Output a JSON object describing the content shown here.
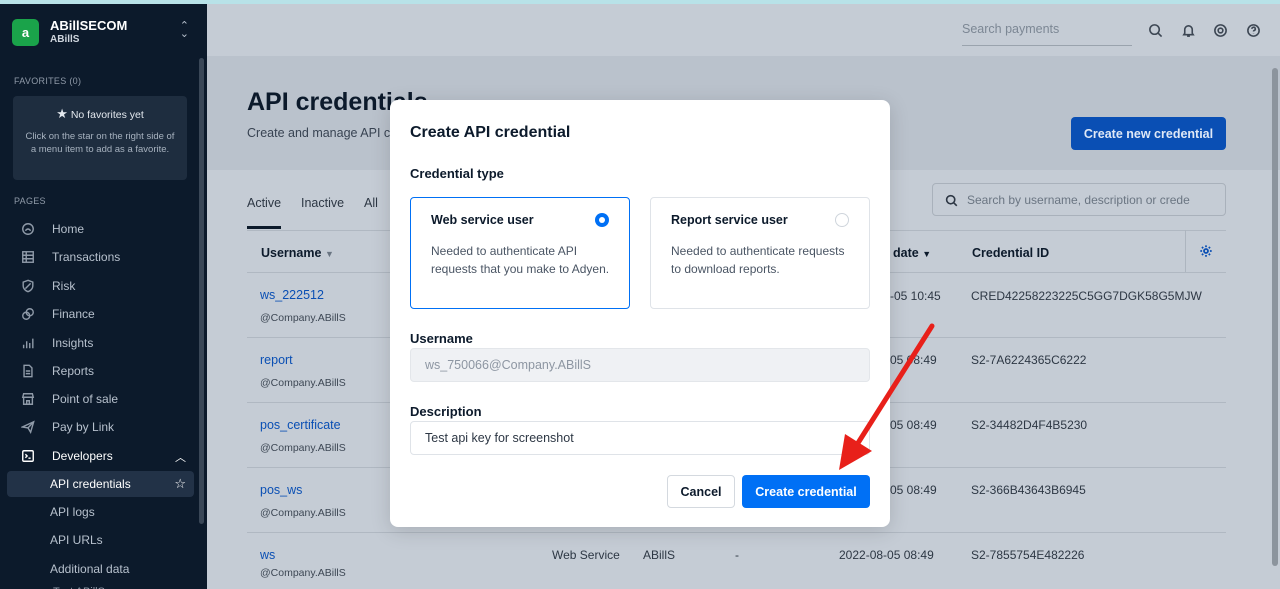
{
  "account": {
    "logo": "a",
    "name": "ABillSECOM",
    "sub": "ABillS"
  },
  "sidebar": {
    "favorites_label": "FAVORITES (0)",
    "favorites_title": "No favorites yet",
    "favorites_desc": "Click on the star on the right side of a menu item to add as a favorite.",
    "pages_label": "PAGES",
    "items": [
      {
        "label": "Home",
        "icon": "home-icon"
      },
      {
        "label": "Transactions",
        "icon": "table-icon"
      },
      {
        "label": "Risk",
        "icon": "shield-icon"
      },
      {
        "label": "Finance",
        "icon": "coins-icon"
      },
      {
        "label": "Insights",
        "icon": "bar-chart-icon"
      },
      {
        "label": "Reports",
        "icon": "document-icon"
      },
      {
        "label": "Point of sale",
        "icon": "store-icon"
      },
      {
        "label": "Pay by Link",
        "icon": "send-icon"
      },
      {
        "label": "Developers",
        "icon": "terminal-icon"
      }
    ],
    "sub_items": [
      {
        "label": "API credentials"
      },
      {
        "label": "API logs"
      },
      {
        "label": "API URLs"
      },
      {
        "label": "Additional data"
      }
    ],
    "cutoff_label": "Test ABillS"
  },
  "topbar": {
    "search_placeholder": "Search payments"
  },
  "page": {
    "title": "API credentials",
    "subtitle": "Create and manage API cre",
    "create_button": "Create new credential",
    "tabs": [
      "Active",
      "Inactive",
      "All"
    ],
    "filter_placeholder": "Search by username, description or crede"
  },
  "table": {
    "headers": {
      "username": "Username",
      "date": "date",
      "credential_id": "Credential ID"
    },
    "rows": [
      {
        "username": "ws_222512",
        "company": "@Company.ABillS",
        "type": "",
        "account": "",
        "desc": "",
        "date": "-05 10:45",
        "id": "CRED42258223225C5GG7DGK58G5MJW"
      },
      {
        "username": "report",
        "company": "@Company.ABillS",
        "type": "",
        "account": "",
        "desc": "",
        "date": "05 08:49",
        "id": "S2-7A6224365C6222"
      },
      {
        "username": "pos_certificate",
        "company": "@Company.ABillS",
        "type": "",
        "account": "",
        "desc": "",
        "date": "05 08:49",
        "id": "S2-34482D4F4B5230"
      },
      {
        "username": "pos_ws",
        "company": "@Company.ABillS",
        "type": "",
        "account": "",
        "desc": "",
        "date": "05 08:49",
        "id": "S2-366B43643B6945"
      },
      {
        "username": "ws",
        "company": "@Company.ABillS",
        "type": "Web Service",
        "account": "ABillS",
        "desc": "-",
        "date": "2022-08-05 08:49",
        "id": "S2-7855754E482226"
      }
    ]
  },
  "modal": {
    "title": "Create API credential",
    "type_label": "Credential type",
    "options": [
      {
        "title": "Web service user",
        "desc": "Needed to authenticate API requests that you make to Adyen.",
        "selected": true
      },
      {
        "title": "Report service user",
        "desc": "Needed to authenticate requests to download reports.",
        "selected": false
      }
    ],
    "username_label": "Username",
    "username_value": "ws_750066@Company.ABillS",
    "description_label": "Description",
    "description_value": "Test api key for screenshot",
    "cancel": "Cancel",
    "create": "Create credential"
  },
  "colors": {
    "accent": "#0070f5",
    "sidebar_bg": "#0c1a2b",
    "brand_green": "#1aa34a",
    "annotation_arrow": "#e8201a"
  }
}
